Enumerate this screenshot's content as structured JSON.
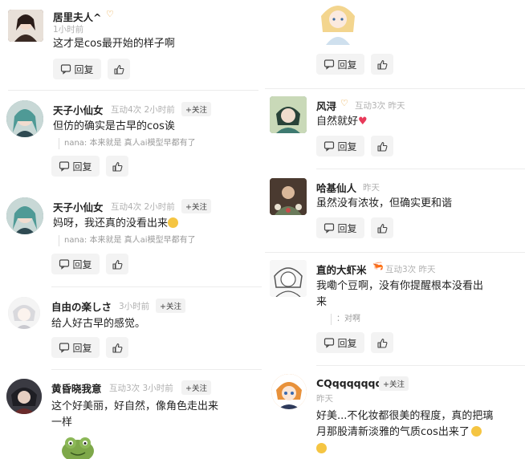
{
  "labels": {
    "reply": "回复",
    "follow": "+关注"
  },
  "left": [
    {
      "name": "居里夫人^",
      "badge": "♡",
      "time": "1小时前",
      "text": "这才是cos最开始的样子啊",
      "avatar_color": "#5a3a32"
    },
    {
      "name": "天子小仙女",
      "meta": "互动4次  2小时前",
      "text": "但仿的确实是古早的cos诶",
      "quote": "nana: 本来就是 真人ai模型早都有了",
      "avatar_color": "#5a8c8a"
    },
    {
      "name": "天子小仙女",
      "meta": "互动4次  2小时前",
      "text": "妈呀，我还真的没看出来",
      "quote": "nana: 本来就是 真人ai模型早都有了",
      "avatar_color": "#5a8c8a"
    },
    {
      "name": "自由の楽しさ",
      "meta": "3小时前",
      "text": "给人好古早的感觉。",
      "avatar_color": "#d8d8d8"
    },
    {
      "name": "黄昏晓我意",
      "meta": "互动3次  3小时前",
      "text_line1": "这个好美丽，好自然，像角色走出来",
      "text_line2": "一样",
      "avatar_color": "#3c3c44"
    }
  ],
  "right": [
    {
      "avatar_color": "#f2d9a0"
    },
    {
      "name": "风浔",
      "badge": "♡",
      "meta": "互动3次  昨天",
      "text": "自然就好",
      "avatar_color": "#4c7a62"
    },
    {
      "name": "哈基仙人",
      "meta": "昨天",
      "text": "虽然没有浓妆，但确实更和谐",
      "avatar_color": "#5a3a2c"
    },
    {
      "name": "直的大虾米",
      "badge": "🦐",
      "meta": "互动3次  昨天",
      "text_line1": "我嘞个豆啊，没有你提醒根本没看出",
      "text_line2": "来",
      "quote": "：对啊",
      "avatar_color": "#e6e6e6"
    },
    {
      "name": "CQqqqqqqq",
      "meta": "昨天",
      "text_line1": "好美...不化妆都很美的程度，真的把璃",
      "text_line2": "月那股清新淡雅的气质cos出来了",
      "avatar_color": "#e8913a"
    }
  ]
}
